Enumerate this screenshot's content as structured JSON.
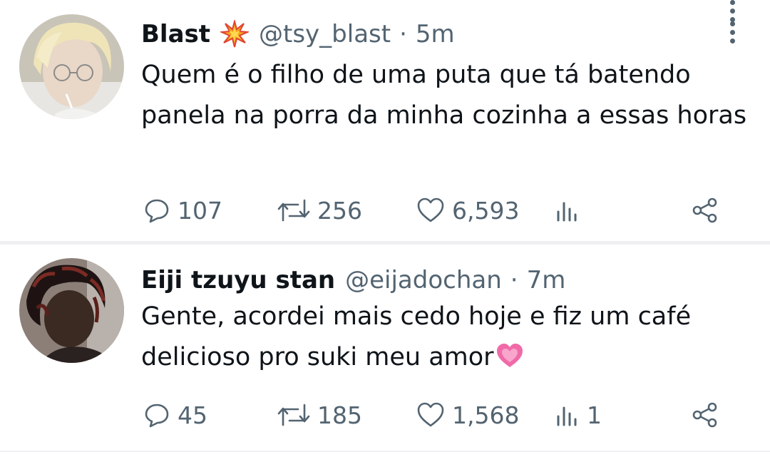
{
  "tweets": [
    {
      "name": "Blast",
      "name_emoji": "collision-emoji",
      "handle": "@tsy_blast",
      "separator": "·",
      "time": "5m",
      "text": "Quem é o filho de uma puta que tá batendo panela na porra da minha cozinha a essas horas",
      "replies": "107",
      "retweets": "256",
      "likes": "6,593",
      "views": ""
    },
    {
      "name": "Eiji tzuyu stan",
      "handle": "@eijadochan",
      "separator": "·",
      "time": "7m",
      "text": "Gente, acordei mais cedo hoje e fiz um café delicioso pro suki meu amor",
      "text_emoji": "heart-emoji",
      "replies": "45",
      "retweets": "185",
      "likes": "1,568",
      "views": "1"
    }
  ],
  "colors": {
    "primary_text": "#0f1419",
    "secondary_text": "#536471",
    "divider": "#eef0f2",
    "heart_pink": "#f06aa8"
  },
  "icons": [
    "reply-icon",
    "retweet-icon",
    "like-icon",
    "views-icon",
    "share-icon",
    "more-options-icon"
  ]
}
